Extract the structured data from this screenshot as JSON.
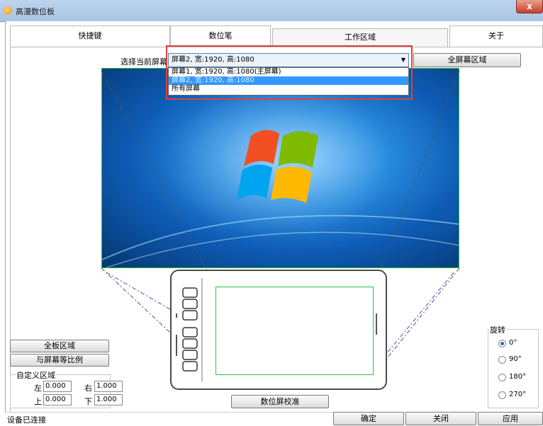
{
  "window": {
    "title": "高漫数位板",
    "close_label": "x"
  },
  "tabs": [
    {
      "label": "快捷键"
    },
    {
      "label": "数位笔"
    },
    {
      "label": "工作区域"
    },
    {
      "label": "关于"
    }
  ],
  "screen_select": {
    "label": "选择当前屏幕",
    "value": "屏幕2, 宽:1920, 高:1080",
    "options": [
      "屏幕1, 宽:1920, 高:1080(主屏幕)",
      "屏幕2, 宽:1920, 高:1080",
      "所有屏幕"
    ],
    "selected_index": 1
  },
  "fullscreen_button": "全屏幕区域",
  "left_panel": {
    "full_board_button": "全板区域",
    "ratio_button": "与屏幕等比例",
    "custom_area": {
      "title": "自定义区域",
      "left_label": "左",
      "left_value": "0.000",
      "right_label": "右",
      "right_value": "1.000",
      "top_label": "上",
      "top_value": "0.000",
      "bottom_label": "下",
      "bottom_value": "1.000"
    }
  },
  "rotation": {
    "title": "旋转",
    "options": [
      "0°",
      "90°",
      "180°",
      "270°"
    ],
    "selected": "0°"
  },
  "calibrate_button": "数位屏校准",
  "status": "设备已连接",
  "footer": {
    "ok": "确定",
    "close": "关闭",
    "apply": "应用"
  },
  "colors": {
    "accent": "#3399ff",
    "highlight_box": "#e0403c",
    "active_area": "#33c13a"
  }
}
